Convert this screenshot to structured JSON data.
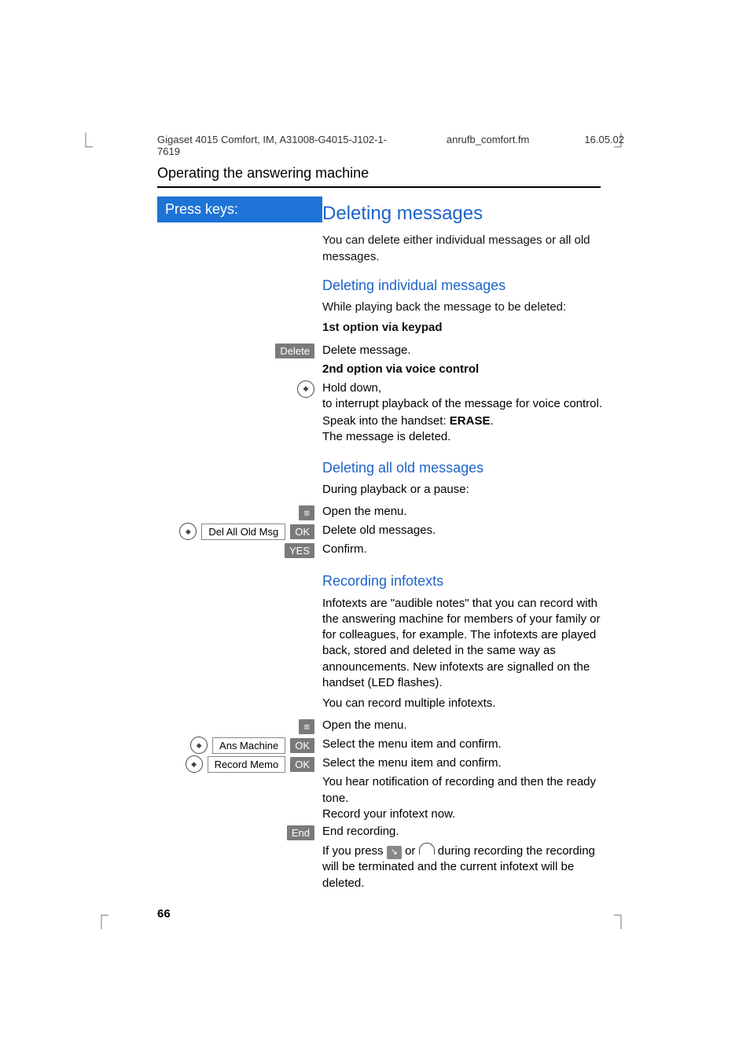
{
  "meta": {
    "product": "Gigaset 4015 Comfort, IM, A31008-G4015-J102-1-7619",
    "filename": "anrufb_comfort.fm",
    "date": "16.05.02"
  },
  "section_title": "Operating the answering machine",
  "press_keys_label": "Press keys:",
  "h1": "Deleting messages",
  "intro": "You can delete either individual messages or all old messages.",
  "h2_individual": "Deleting individual messages",
  "individual_intro": "While playing back the message to be deleted:",
  "opt1_title": "1st option via keypad",
  "badges": {
    "delete": "Delete",
    "ok": "OK",
    "yes": "YES",
    "end": "End",
    "menu": "≡"
  },
  "opt1_action": "Delete message.",
  "opt2_title": "2nd option via voice control",
  "opt2_action_a": "Hold down,",
  "opt2_action_b": "to interrupt playback of the message for voice control.",
  "opt2_speak_pre": "Speak into the handset: ",
  "opt2_speak_word": "ERASE",
  "opt2_speak_post": ".",
  "opt2_result": "The message is deleted.",
  "h2_allold": "Deleting all old messages",
  "allold_intro": "During playback or a pause:",
  "allold_openmenu": "Open the menu.",
  "menu_del_all": "Del All Old Msg",
  "allold_delete": "Delete old messages.",
  "allold_confirm": "Confirm.",
  "h2_infotexts": "Recording infotexts",
  "info_para": "Infotexts are \"audible notes\" that you can record with the answering machine for members of your family or for colleagues, for example. The infotexts are played back, stored and deleted in the same way as announcements. New infotexts are signalled on the handset (LED flashes).",
  "info_multiple": "You can record multiple infotexts.",
  "info_openmenu": "Open the menu.",
  "menu_ans_machine": "Ans Machine",
  "info_select1": "Select the menu item and confirm.",
  "menu_record_memo": "Record Memo",
  "info_select2": "Select the menu item and confirm.",
  "info_tone": "You hear notification of recording and then the ready tone.",
  "info_record_now": "Record your infotext now.",
  "info_end": "End recording.",
  "info_terminate_pre": "If you press ",
  "info_terminate_mid": " or ",
  "info_terminate_post": " during recording the recording will be terminated and the current infotext will be deleted.",
  "page_number": "66"
}
